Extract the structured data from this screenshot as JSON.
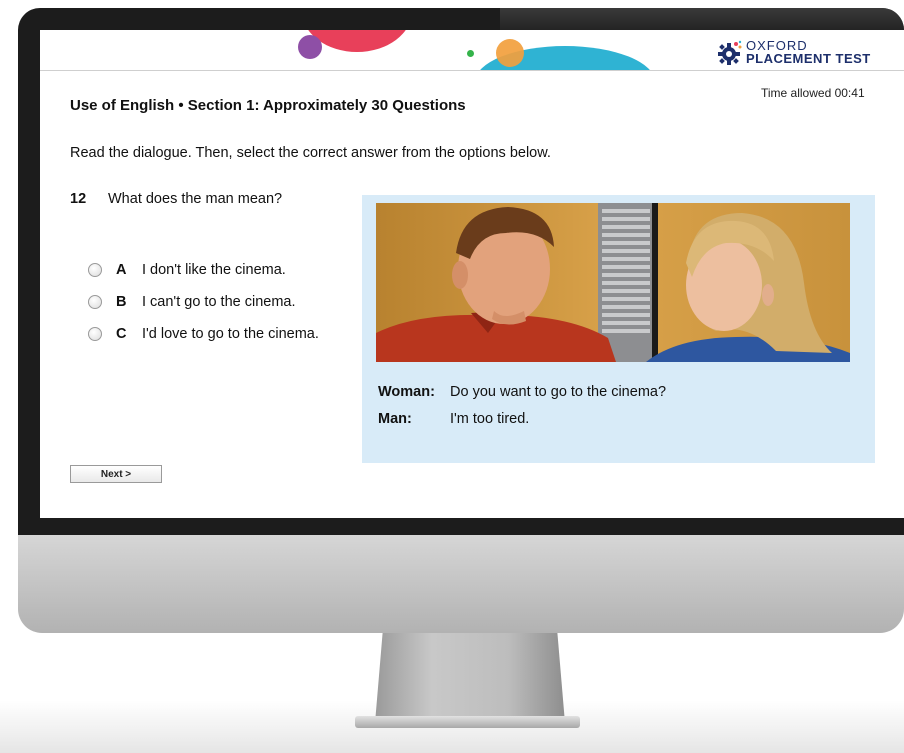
{
  "header": {
    "logo_line1": "OXFORD",
    "logo_line2": "PLACEMENT TEST",
    "brand_color": "#1d2f6b"
  },
  "timer": "Time allowed 00:41",
  "section_title": "Use of English • Section 1: Approximately 30 Questions",
  "instruction": "Read the dialogue. Then, select the correct answer from the options below.",
  "question": {
    "number": "12",
    "text": "What does the man mean?",
    "options": [
      {
        "letter": "A",
        "text": "I don't like the cinema."
      },
      {
        "letter": "B",
        "text": "I can't go to the cinema."
      },
      {
        "letter": "C",
        "text": "I'd love to go to the cinema."
      }
    ]
  },
  "dialogue": {
    "panel_color": "#d8ebf8",
    "lines": [
      {
        "speaker": "Woman:",
        "text": "Do you want to go to the cinema?"
      },
      {
        "speaker": "Man:",
        "text": "I'm too tired."
      }
    ]
  },
  "next_button": "Next >",
  "icons": {
    "logo": "gear-logo-icon",
    "radio": "radio-button-icon"
  }
}
